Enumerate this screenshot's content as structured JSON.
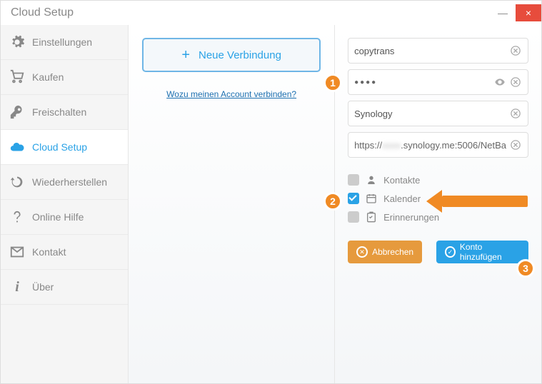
{
  "title": "Cloud Setup",
  "window": {
    "minimize": "—",
    "close": "×"
  },
  "sidebar": {
    "items": [
      {
        "label": "Einstellungen"
      },
      {
        "label": "Kaufen"
      },
      {
        "label": "Freischalten"
      },
      {
        "label": "Cloud Setup"
      },
      {
        "label": "Wiederherstellen"
      },
      {
        "label": "Online Hilfe"
      },
      {
        "label": "Kontakt"
      },
      {
        "label": "Über"
      }
    ]
  },
  "middle": {
    "new_connection": "Neue Verbindung",
    "why_link": "Wozu meinen Account verbinden?"
  },
  "form": {
    "username": "copytrans",
    "password_mask": "●●●●",
    "account_name": "Synology",
    "url_prefix": "https://",
    "url_suffix": ".synology.me:5006/NetBa"
  },
  "sync": {
    "contacts": "Kontakte",
    "calendar": "Kalender",
    "reminders": "Erinnerungen"
  },
  "buttons": {
    "cancel": "Abbrechen",
    "add": "Konto hinzufügen"
  },
  "badges": {
    "one": "1",
    "two": "2",
    "three": "3"
  }
}
